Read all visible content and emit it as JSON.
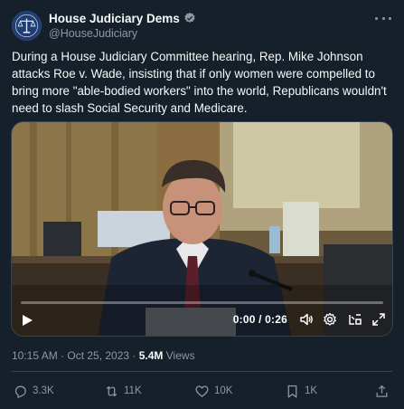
{
  "account": {
    "display_name": "House Judiciary Dems",
    "handle": "@HouseJudiciary",
    "avatar_icon": "scales-of-justice-icon",
    "verified_color": "#8b98a5"
  },
  "tweet": {
    "text": "During a House Judiciary Committee hearing, Rep. Mike Johnson attacks Roe v. Wade, insisting that if only women were compelled to bring more \"able-bodied workers\" into the world, Republicans wouldn't need to slash Social Security and Medicare."
  },
  "video": {
    "time_display": "0:00 / 0:26",
    "progress": 0,
    "controls": [
      "play-icon",
      "volume-icon",
      "settings-icon",
      "pip-icon",
      "fullscreen-icon"
    ]
  },
  "meta": {
    "timestamp": "10:15 AM · Oct 25, 2023 · ",
    "views_count": "5.4M",
    "views_label": " Views"
  },
  "actions": {
    "replies": "3.3K",
    "retweets": "11K",
    "likes": "10K",
    "bookmarks": "1K"
  },
  "colors": {
    "background": "#15202b",
    "text": "#f7f9f9",
    "secondary": "#8b98a5",
    "accent": "#1d9bf0",
    "border": "#38444d"
  }
}
